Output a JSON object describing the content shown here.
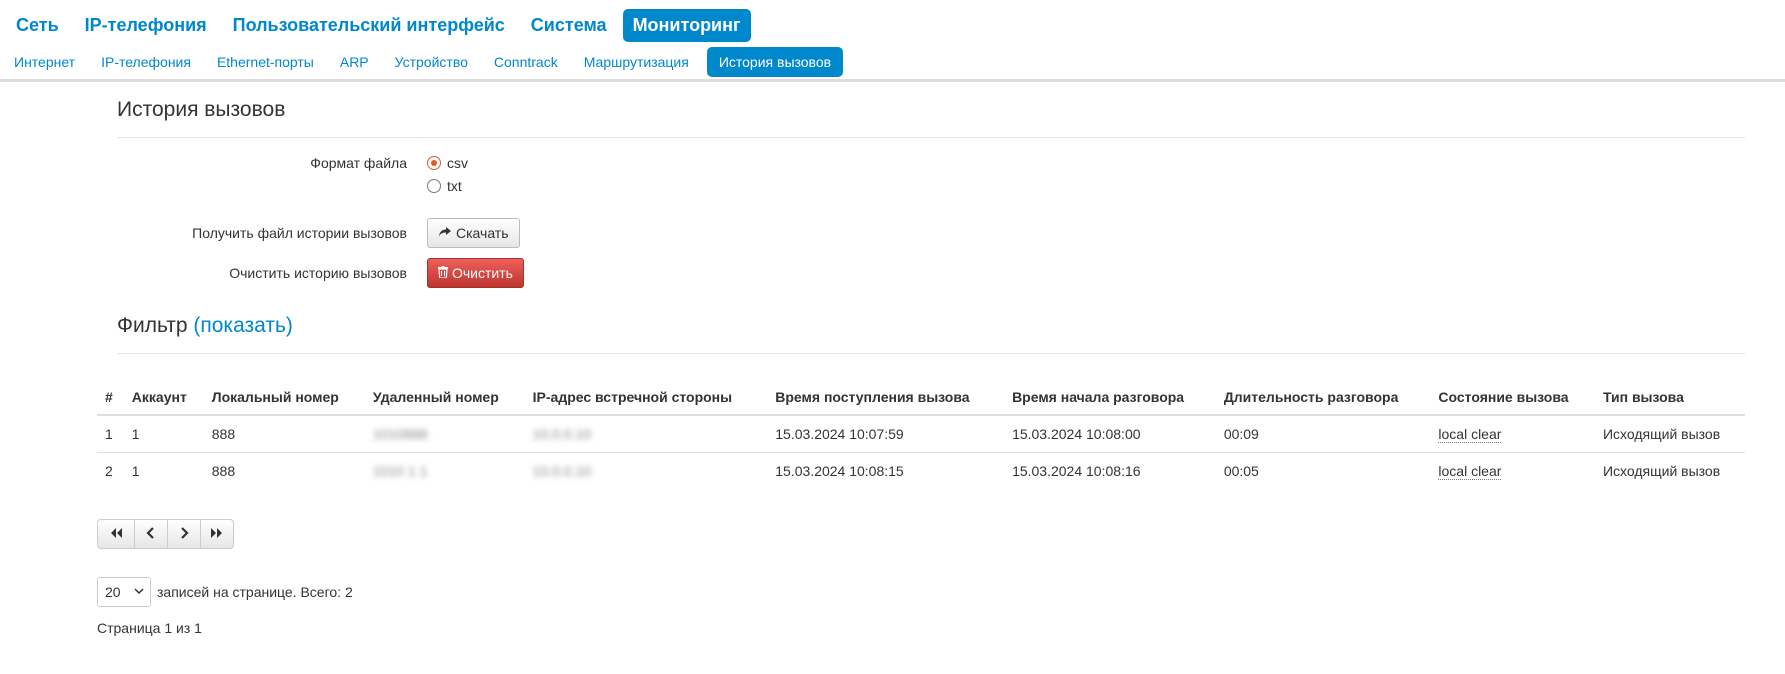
{
  "topnav": {
    "items": [
      "Сеть",
      "IP-телефония",
      "Пользовательский интерфейс",
      "Система",
      "Мониторинг"
    ],
    "active": "Мониторинг"
  },
  "subnav": {
    "items": [
      "Интернет",
      "IP-телефония",
      "Ethernet-порты",
      "ARP",
      "Устройство",
      "Conntrack",
      "Маршрутизация",
      "История вызовов"
    ],
    "active": "История вызовов"
  },
  "section1": {
    "title": "История вызовов",
    "format_label": "Формат файла",
    "format_options": [
      "csv",
      "txt"
    ],
    "format_selected": "csv",
    "download_label": "Получить файл истории вызовов",
    "download_button": "Скачать",
    "clear_label": "Очистить историю вызовов",
    "clear_button": "Очистить"
  },
  "filter": {
    "title": "Фильтр",
    "toggle": "(показать)"
  },
  "table": {
    "columns": [
      "#",
      "Аккаунт",
      "Локальный номер",
      "Удаленный номер",
      "IP-адрес встречной стороны",
      "Время поступления вызова",
      "Время начала разговора",
      "Длительность разговора",
      "Состояние вызова",
      "Тип вызова"
    ],
    "rows": [
      {
        "num": "1",
        "account": "1",
        "local": "888",
        "remote": "1010888",
        "ip": "10.0.0.10",
        "received": "15.03.2024 10:07:59",
        "started": "15.03.2024 10:08:00",
        "duration": "00:09",
        "state": "local clear",
        "type": "Исходящий вызов"
      },
      {
        "num": "2",
        "account": "1",
        "local": "888",
        "remote": "1010 1 1",
        "ip": "10.0.0.10",
        "received": "15.03.2024 10:08:15",
        "started": "15.03.2024 10:08:16",
        "duration": "00:05",
        "state": "local clear",
        "type": "Исходящий вызов"
      }
    ]
  },
  "pager": {
    "buttons": [
      "first-page",
      "prev-page",
      "next-page",
      "last-page"
    ]
  },
  "perpage": {
    "value": "20",
    "text": "записей на странице. Всего: 2"
  },
  "pageinfo": "Страница 1 из 1",
  "colors": {
    "accent": "#0088cc",
    "danger": "#da4f49",
    "radio_checked": "#e05a20"
  }
}
